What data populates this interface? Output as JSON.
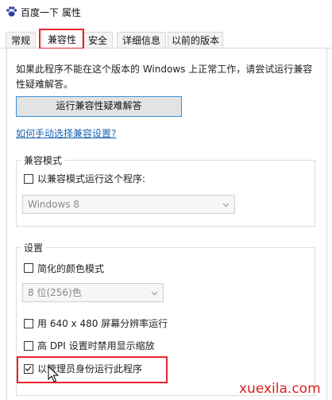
{
  "window": {
    "title": "百度一下 属性"
  },
  "tabs": [
    {
      "label": "常规",
      "active": false
    },
    {
      "label": "兼容性",
      "active": true
    },
    {
      "label": "安全",
      "active": false
    },
    {
      "label": "详细信息",
      "active": false
    },
    {
      "label": "以前的版本",
      "active": false
    }
  ],
  "intro_text": "如果此程序不能在这个版本的 Windows 上正常工作，请尝试运行兼容性疑难解答。",
  "troubleshooter_button": "运行兼容性疑难解答",
  "manual_link": "如何手动选择兼容设置?",
  "compat_mode": {
    "group_label": "兼容模式",
    "checkbox_label": "以兼容模式运行这个程序:",
    "checked": false,
    "os_select_value": "Windows 8"
  },
  "settings": {
    "group_label": "设置",
    "reduced_color": {
      "label": "简化的颜色模式",
      "checked": false
    },
    "color_select_value": "8 位(256)色",
    "res_640": {
      "label": "用 640 x 480 屏幕分辨率运行",
      "checked": false
    },
    "high_dpi": {
      "label": "高 DPI 设置时禁用显示缩放",
      "checked": false
    },
    "run_as_admin": {
      "label": "以管理员身份运行此程序",
      "checked": true
    }
  },
  "watermark": "xuexila.com",
  "colors": {
    "highlight": "#e8242c",
    "link": "#1a63b6",
    "button_border": "#3c8fd6"
  }
}
